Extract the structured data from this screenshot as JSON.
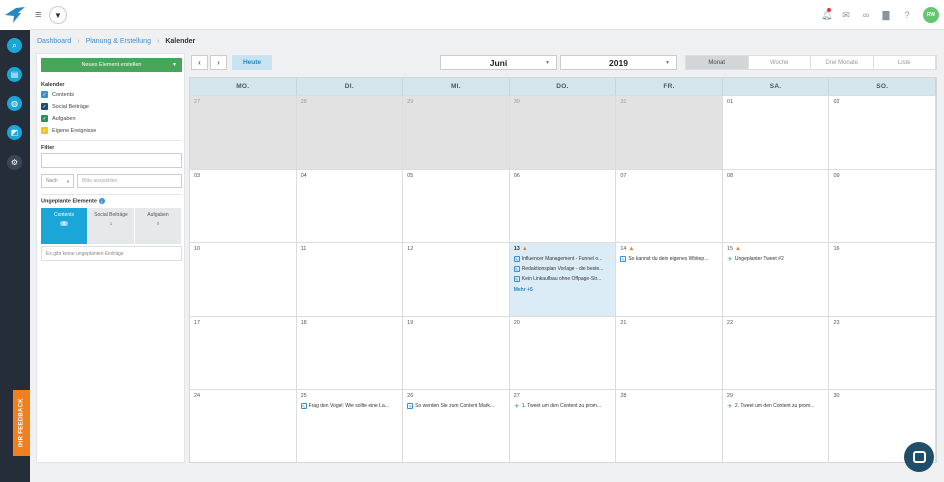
{
  "topbar": {
    "filter_icon": "funnel-icon",
    "avatar_initials": "RW",
    "icons": [
      "bell-icon",
      "mail-icon",
      "link-icon",
      "chat-icon",
      "help-icon"
    ]
  },
  "rail": {
    "feedback_label": "IHR FEEDBACK",
    "icons": [
      "search-icon",
      "calendar-icon",
      "globe-icon",
      "chart-icon",
      "gear-icon"
    ]
  },
  "breadcrumb": {
    "items": [
      "Dashboard",
      "Planung & Erstellung",
      "Kalender"
    ]
  },
  "panel": {
    "new_button": "Neues Element erstellen",
    "calendar_label": "Kalender",
    "calendars": [
      {
        "label": "Contents",
        "color": "#3a8fd0"
      },
      {
        "label": "Social Beiträge",
        "color": "#1e4e6a"
      },
      {
        "label": "Aufgaben",
        "color": "#2f8f5b"
      },
      {
        "label": "Eigene Ereignisse",
        "color": "#f0c419"
      }
    ],
    "filter_label": "Filter",
    "nach_select": "Nach",
    "bitte_placeholder": "Bitte auswählen",
    "unplanned_label": "Ungeplante Elemente",
    "tabs": [
      {
        "label": "Contents",
        "count": "0"
      },
      {
        "label": "Social Beiträge",
        "count": "1"
      },
      {
        "label": "Aufgaben",
        "count": "0"
      }
    ],
    "empty_note": "Es gibt keine ungeplanten Einträge"
  },
  "toolbar": {
    "prev": "‹",
    "next": "›",
    "today": "Heute",
    "month": "Juni",
    "year": "2019",
    "views": [
      "Monat",
      "Woche",
      "Drei Monate",
      "Liste"
    ],
    "active_view": "Monat"
  },
  "calendar": {
    "weekdays": [
      "MO.",
      "DI.",
      "MI.",
      "DO.",
      "FR.",
      "SA.",
      "SO."
    ],
    "more_label": "Mehr +5",
    "weeks": [
      [
        {
          "d": "27",
          "other": true
        },
        {
          "d": "28",
          "other": true
        },
        {
          "d": "29",
          "other": true
        },
        {
          "d": "30",
          "other": true
        },
        {
          "d": "31",
          "other": true
        },
        {
          "d": "01"
        },
        {
          "d": "02"
        }
      ],
      [
        {
          "d": "03"
        },
        {
          "d": "04"
        },
        {
          "d": "05"
        },
        {
          "d": "06"
        },
        {
          "d": "07"
        },
        {
          "d": "08"
        },
        {
          "d": "09"
        }
      ],
      [
        {
          "d": "10"
        },
        {
          "d": "11"
        },
        {
          "d": "12"
        },
        {
          "d": "13",
          "today": true,
          "warn": true,
          "events": [
            {
              "type": "content",
              "text": "Influencer Management - Funnel o..."
            },
            {
              "type": "content",
              "text": "Redaktionsplan Vorlage - die beste..."
            },
            {
              "type": "content",
              "text": "Kein Linkaufbau ohne Offpage-Str..."
            }
          ],
          "more": true
        },
        {
          "d": "14",
          "warn": true,
          "events": [
            {
              "type": "content",
              "text": "So kannst du dein eigenes Whitep..."
            }
          ]
        },
        {
          "d": "15",
          "warn": true,
          "events": [
            {
              "type": "tweet",
              "text": "Ungeplanter Tweet #2"
            }
          ]
        },
        {
          "d": "16"
        }
      ],
      [
        {
          "d": "17"
        },
        {
          "d": "18"
        },
        {
          "d": "19"
        },
        {
          "d": "20"
        },
        {
          "d": "21"
        },
        {
          "d": "22"
        },
        {
          "d": "23"
        }
      ],
      [
        {
          "d": "24"
        },
        {
          "d": "25",
          "events": [
            {
              "type": "content",
              "text": "Frag den Vogel: Wie sollte eine La..."
            }
          ]
        },
        {
          "d": "26",
          "events": [
            {
              "type": "content",
              "text": "So werden Sie zum Content Mark..."
            }
          ]
        },
        {
          "d": "27",
          "events": [
            {
              "type": "tweet",
              "text": "1. Tweet um den Content zu prom..."
            }
          ]
        },
        {
          "d": "28"
        },
        {
          "d": "29",
          "events": [
            {
              "type": "tweet",
              "text": "2. Tweet um den Content zu prom..."
            }
          ]
        },
        {
          "d": "30"
        }
      ]
    ]
  }
}
